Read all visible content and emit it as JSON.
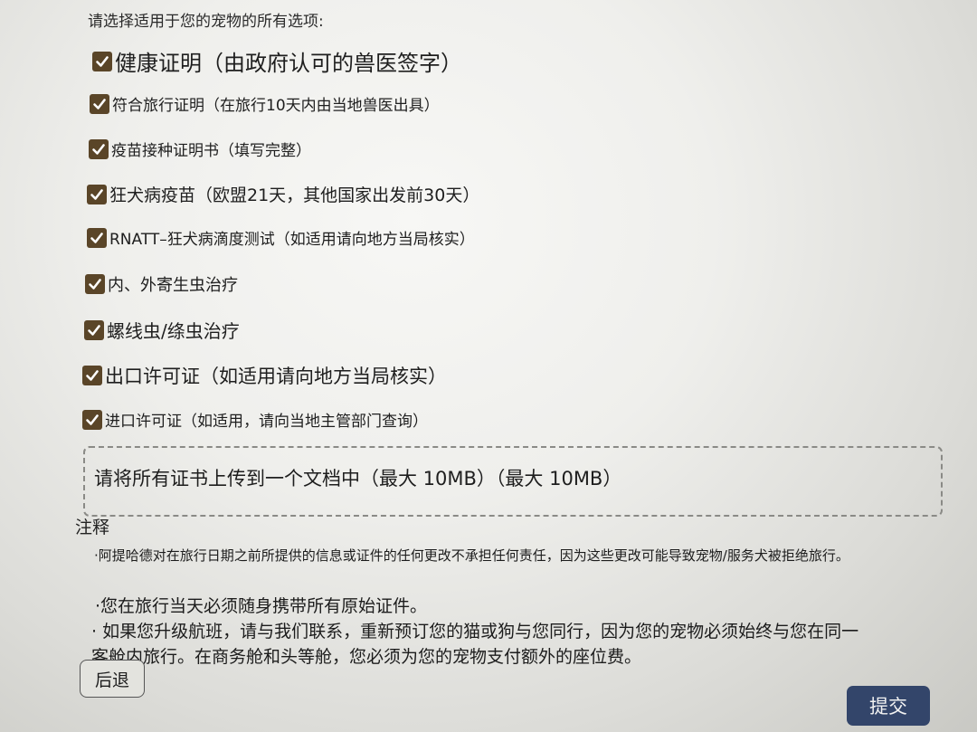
{
  "form": {
    "intro": "请选择适用于您的宠物的所有选项:",
    "checkboxes": [
      {
        "label": "健康证明（由政府认可的兽医签字）",
        "checked": true
      },
      {
        "label": "符合旅行证明（在旅行10天内由当地兽医出具）",
        "checked": true
      },
      {
        "label": "疫苗接种证明书（填写完整）",
        "checked": true
      },
      {
        "label": "狂犬病疫苗（欧盟21天，其他国家出发前30天）",
        "checked": true
      },
      {
        "label": "RNATT–狂犬病滴度测试（如适用请向地方当局核实）",
        "checked": true
      },
      {
        "label": "内、外寄生虫治疗",
        "checked": true
      },
      {
        "label": "螺线虫/绦虫治疗",
        "checked": true
      },
      {
        "label": "出口许可证（如适用请向地方当局核实）",
        "checked": true
      },
      {
        "label": "进口许可证（如适用，请向当地主管部门查询）",
        "checked": true
      }
    ],
    "upload_label": "请将所有证书上传到一个文档中（最大 10MB）（最大 10MB）"
  },
  "notes": {
    "heading": "注释",
    "items": [
      "·阿提哈德对在旅行日期之前所提供的信息或证件的任何更改不承担任何责任，因为这些更改可能导致宠物/服务犬被拒绝旅行。",
      "·您在旅行当天必须随身携带所有原始证件。",
      "· 如果您升级航班，请与我们联系，重新预订您的猫或狗与您同行，因为您的宠物必须始终与您在同一",
      "客舱内旅行。在商务舱和头等舱，您必须为您的宠物支付额外的座位费。"
    ]
  },
  "buttons": {
    "back": "后退",
    "submit": "提交"
  },
  "colors": {
    "checkbox": "#5a4528",
    "submit_button": "#33456a"
  }
}
